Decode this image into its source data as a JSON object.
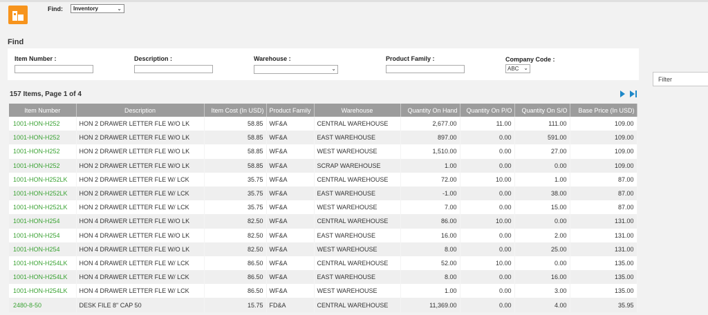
{
  "find_bar": {
    "label": "Find:",
    "selected": "Inventory"
  },
  "section_title": "Find",
  "filters": {
    "item_number": {
      "label": "Item Number :",
      "value": ""
    },
    "description": {
      "label": "Description :",
      "value": ""
    },
    "warehouse": {
      "label": "Warehouse :",
      "value": ""
    },
    "product_family": {
      "label": "Product Family :",
      "value": ""
    },
    "company_code": {
      "label": "Company Code :",
      "value": "ABC"
    }
  },
  "side_filter": {
    "label": "Filter"
  },
  "results": {
    "summary": "157 Items, Page 1 of 4"
  },
  "table": {
    "columns": [
      "Item Number",
      "Description",
      "Item Cost (In USD)",
      "Product Family",
      "Warehouse",
      "Quantity On Hand",
      "Quantity On P/O",
      "Quantity On S/O",
      "Base Price (In USD)"
    ],
    "rows": [
      [
        "1001-HON-H252",
        "HON 2 DRAWER LETTER FLE W/O LK",
        "58.85",
        "WF&A",
        "CENTRAL WAREHOUSE",
        "2,677.00",
        "11.00",
        "111.00",
        "109.00"
      ],
      [
        "1001-HON-H252",
        "HON 2 DRAWER LETTER FLE W/O LK",
        "58.85",
        "WF&A",
        "EAST WAREHOUSE",
        "897.00",
        "0.00",
        "591.00",
        "109.00"
      ],
      [
        "1001-HON-H252",
        "HON 2 DRAWER LETTER FLE W/O LK",
        "58.85",
        "WF&A",
        "WEST WAREHOUSE",
        "1,510.00",
        "0.00",
        "27.00",
        "109.00"
      ],
      [
        "1001-HON-H252",
        "HON 2 DRAWER LETTER FLE W/O LK",
        "58.85",
        "WF&A",
        "SCRAP WAREHOUSE",
        "1.00",
        "0.00",
        "0.00",
        "109.00"
      ],
      [
        "1001-HON-H252LK",
        "HON 2 DRAWER LETTER FLE W/ LCK",
        "35.75",
        "WF&A",
        "CENTRAL WAREHOUSE",
        "72.00",
        "10.00",
        "1.00",
        "87.00"
      ],
      [
        "1001-HON-H252LK",
        "HON 2 DRAWER LETTER FLE W/ LCK",
        "35.75",
        "WF&A",
        "EAST WAREHOUSE",
        "-1.00",
        "0.00",
        "38.00",
        "87.00"
      ],
      [
        "1001-HON-H252LK",
        "HON 2 DRAWER LETTER FLE W/ LCK",
        "35.75",
        "WF&A",
        "WEST WAREHOUSE",
        "7.00",
        "0.00",
        "15.00",
        "87.00"
      ],
      [
        "1001-HON-H254",
        "HON 4 DRAWER LETTER FLE W/O LK",
        "82.50",
        "WF&A",
        "CENTRAL WAREHOUSE",
        "86.00",
        "10.00",
        "0.00",
        "131.00"
      ],
      [
        "1001-HON-H254",
        "HON 4 DRAWER LETTER FLE W/O LK",
        "82.50",
        "WF&A",
        "EAST WAREHOUSE",
        "16.00",
        "0.00",
        "2.00",
        "131.00"
      ],
      [
        "1001-HON-H254",
        "HON 4 DRAWER LETTER FLE W/O LK",
        "82.50",
        "WF&A",
        "WEST WAREHOUSE",
        "8.00",
        "0.00",
        "25.00",
        "131.00"
      ],
      [
        "1001-HON-H254LK",
        "HON 4 DRAWER LETTER FLE W/ LCK",
        "86.50",
        "WF&A",
        "CENTRAL WAREHOUSE",
        "52.00",
        "10.00",
        "0.00",
        "135.00"
      ],
      [
        "1001-HON-H254LK",
        "HON 4 DRAWER LETTER FLE W/ LCK",
        "86.50",
        "WF&A",
        "EAST WAREHOUSE",
        "8.00",
        "0.00",
        "16.00",
        "135.00"
      ],
      [
        "1001-HON-H254LK",
        "HON 4 DRAWER LETTER FLE W/ LCK",
        "86.50",
        "WF&A",
        "WEST WAREHOUSE",
        "1.00",
        "0.00",
        "3.00",
        "135.00"
      ],
      [
        "2480-8-50",
        "DESK FILE 8\" CAP 50",
        "15.75",
        "FD&A",
        "CENTRAL WAREHOUSE",
        "11,369.00",
        "0.00",
        "4.00",
        "35.95"
      ]
    ]
  },
  "icons": {
    "logo": "building-logo-icon",
    "next": "next-page-icon",
    "last": "last-page-icon",
    "dropdown": "chevron-down-icon"
  },
  "colors": {
    "accent": "#f7941d",
    "link": "#3aa233",
    "header": "#9c9c9c",
    "pager": "#1e88c8"
  }
}
